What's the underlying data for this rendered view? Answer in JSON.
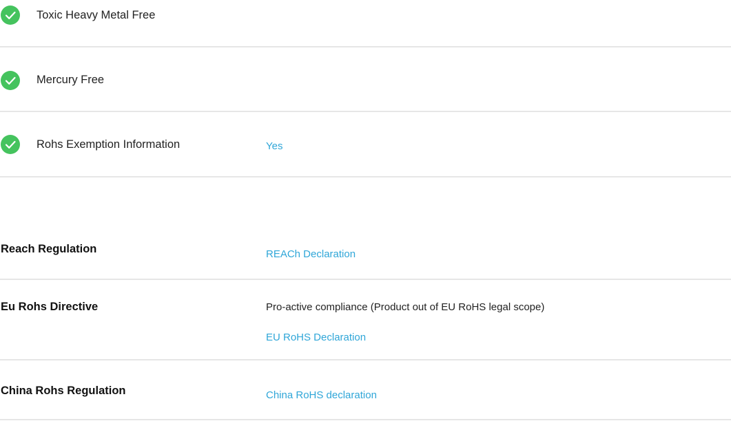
{
  "environmental_checks": [
    {
      "label": "Toxic Heavy Metal Free",
      "icon": "check-circle-icon",
      "value": ""
    },
    {
      "label": "Mercury Free",
      "icon": "check-circle-icon",
      "value": ""
    },
    {
      "label": "Rohs Exemption Information",
      "icon": "check-circle-icon",
      "value": "Yes"
    }
  ],
  "regulations": [
    {
      "label": "Reach Regulation",
      "text": "",
      "link": "REACh Declaration"
    },
    {
      "label": "Eu Rohs Directive",
      "text": "Pro-active compliance (Product out of EU RoHS legal scope)",
      "link": "EU RoHS Declaration"
    },
    {
      "label": "China Rohs Regulation",
      "text": "",
      "link": "China RoHS declaration"
    }
  ],
  "colors": {
    "check_green": "#45c35e",
    "link_blue": "#2fa6d8",
    "divider": "#e6e6e6"
  }
}
